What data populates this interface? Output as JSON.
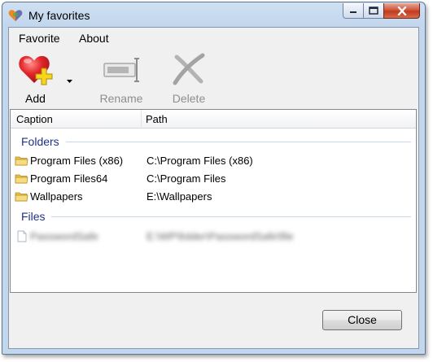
{
  "window": {
    "title": "My favorites"
  },
  "menu": {
    "items": [
      "Favorite",
      "About"
    ]
  },
  "toolbar": {
    "add_label": "Add",
    "rename_label": "Rename",
    "delete_label": "Delete",
    "rename_enabled": false,
    "delete_enabled": false
  },
  "list": {
    "columns": [
      "Caption",
      "Path"
    ],
    "groups": [
      {
        "title": "Folders",
        "items": [
          {
            "caption": "Program Files (x86)",
            "path": "C:\\Program Files (x86)",
            "icon": "folder-icon"
          },
          {
            "caption": "Program Files64",
            "path": "C:\\Program Files",
            "icon": "folder-icon"
          },
          {
            "caption": "Wallpapers",
            "path": "E:\\Wallpapers",
            "icon": "folder-icon"
          }
        ]
      },
      {
        "title": "Files",
        "items": [
          {
            "caption": "PasswordSafe",
            "path": "E:\\WP\\folder\\PasswordSafe\\file",
            "icon": "file-icon",
            "blurred": true
          }
        ]
      }
    ]
  },
  "footer": {
    "close_label": "Close"
  },
  "colors": {
    "group_title": "#1e3287",
    "accent_red": "#e0262b",
    "accent_yellow": "#f5d51d"
  }
}
